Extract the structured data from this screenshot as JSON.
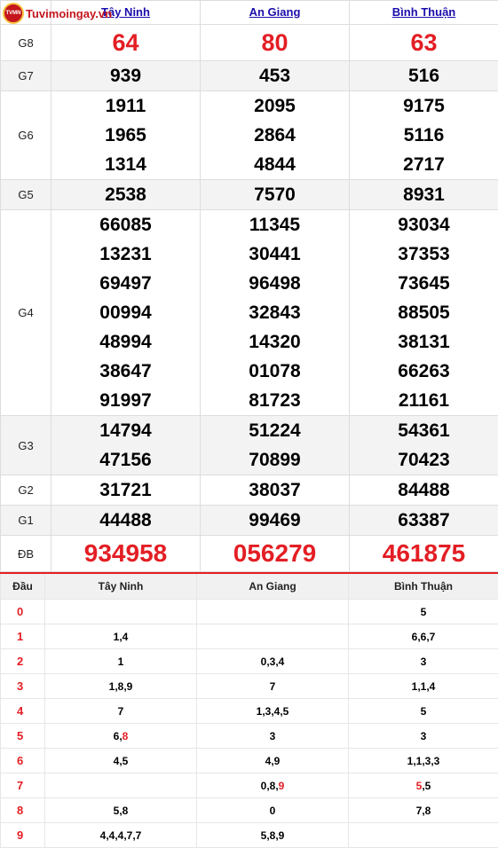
{
  "logo": {
    "text": "Tuvimoingay.vn",
    "badge": "TVMN"
  },
  "provinces": [
    "Tây Ninh",
    "An Giang",
    "Bình Thuận"
  ],
  "prizes": [
    {
      "label": "G8",
      "style": "red-md",
      "values": [
        [
          "64"
        ],
        [
          "80"
        ],
        [
          "63"
        ]
      ]
    },
    {
      "label": "G7",
      "style": "normal",
      "values": [
        [
          "939"
        ],
        [
          "453"
        ],
        [
          "516"
        ]
      ]
    },
    {
      "label": "G6",
      "style": "normal",
      "values": [
        [
          "1911",
          "1965",
          "1314"
        ],
        [
          "2095",
          "2864",
          "4844"
        ],
        [
          "9175",
          "5116",
          "2717"
        ]
      ]
    },
    {
      "label": "G5",
      "style": "normal",
      "values": [
        [
          "2538"
        ],
        [
          "7570"
        ],
        [
          "8931"
        ]
      ]
    },
    {
      "label": "G4",
      "style": "normal",
      "values": [
        [
          "66085",
          "13231",
          "69497",
          "00994",
          "48994",
          "38647",
          "91997"
        ],
        [
          "11345",
          "30441",
          "96498",
          "32843",
          "14320",
          "01078",
          "81723"
        ],
        [
          "93034",
          "37353",
          "73645",
          "88505",
          "38131",
          "66263",
          "21161"
        ]
      ]
    },
    {
      "label": "G3",
      "style": "normal",
      "values": [
        [
          "14794",
          "47156"
        ],
        [
          "51224",
          "70899"
        ],
        [
          "54361",
          "70423"
        ]
      ]
    },
    {
      "label": "G2",
      "style": "normal",
      "values": [
        [
          "31721"
        ],
        [
          "38037"
        ],
        [
          "84488"
        ]
      ]
    },
    {
      "label": "G1",
      "style": "normal",
      "values": [
        [
          "44488"
        ],
        [
          "99469"
        ],
        [
          "63387"
        ]
      ]
    },
    {
      "label": "ĐB",
      "style": "red-lg",
      "values": [
        [
          "934958"
        ],
        [
          "056279"
        ],
        [
          "461875"
        ]
      ]
    }
  ],
  "loto": {
    "head_label": "Đầu",
    "columns": [
      "Tây Ninh",
      "An Giang",
      "Bình Thuận"
    ],
    "rows": [
      {
        "head": "0",
        "cells": [
          [],
          [],
          [
            {
              "t": "5"
            }
          ]
        ]
      },
      {
        "head": "1",
        "cells": [
          [
            {
              "t": "1,4"
            }
          ],
          [],
          [
            {
              "t": "6,6,7"
            }
          ]
        ]
      },
      {
        "head": "2",
        "cells": [
          [
            {
              "t": "1"
            }
          ],
          [
            {
              "t": "0,3,4"
            }
          ],
          [
            {
              "t": "3"
            }
          ]
        ]
      },
      {
        "head": "3",
        "cells": [
          [
            {
              "t": "1,8,9"
            }
          ],
          [
            {
              "t": "7"
            }
          ],
          [
            {
              "t": "1,1,4"
            }
          ]
        ]
      },
      {
        "head": "4",
        "cells": [
          [
            {
              "t": "7"
            }
          ],
          [
            {
              "t": "1,3,4,5"
            }
          ],
          [
            {
              "t": "5"
            }
          ]
        ]
      },
      {
        "head": "5",
        "cells": [
          [
            {
              "t": "6,"
            },
            {
              "t": "8",
              "red": true
            }
          ],
          [
            {
              "t": "3"
            }
          ],
          [
            {
              "t": "3"
            }
          ]
        ]
      },
      {
        "head": "6",
        "cells": [
          [
            {
              "t": "4,5"
            }
          ],
          [
            {
              "t": "4,9"
            }
          ],
          [
            {
              "t": "1,1,3,3"
            }
          ]
        ]
      },
      {
        "head": "7",
        "cells": [
          [],
          [
            {
              "t": "0,8,"
            },
            {
              "t": "9",
              "red": true
            }
          ],
          [
            {
              "t": "5",
              "red": true
            },
            {
              "t": ",5"
            }
          ]
        ]
      },
      {
        "head": "8",
        "cells": [
          [
            {
              "t": "5,8"
            }
          ],
          [
            {
              "t": "0"
            }
          ],
          [
            {
              "t": "7,8"
            }
          ]
        ]
      },
      {
        "head": "9",
        "cells": [
          [
            {
              "t": "4,4,4,7,7"
            }
          ],
          [
            {
              "t": "5,8,9"
            }
          ],
          []
        ]
      }
    ]
  },
  "colors": {
    "red": "#e31e24",
    "link": "#1a0dab",
    "alt_row": "#f3f3f3"
  }
}
